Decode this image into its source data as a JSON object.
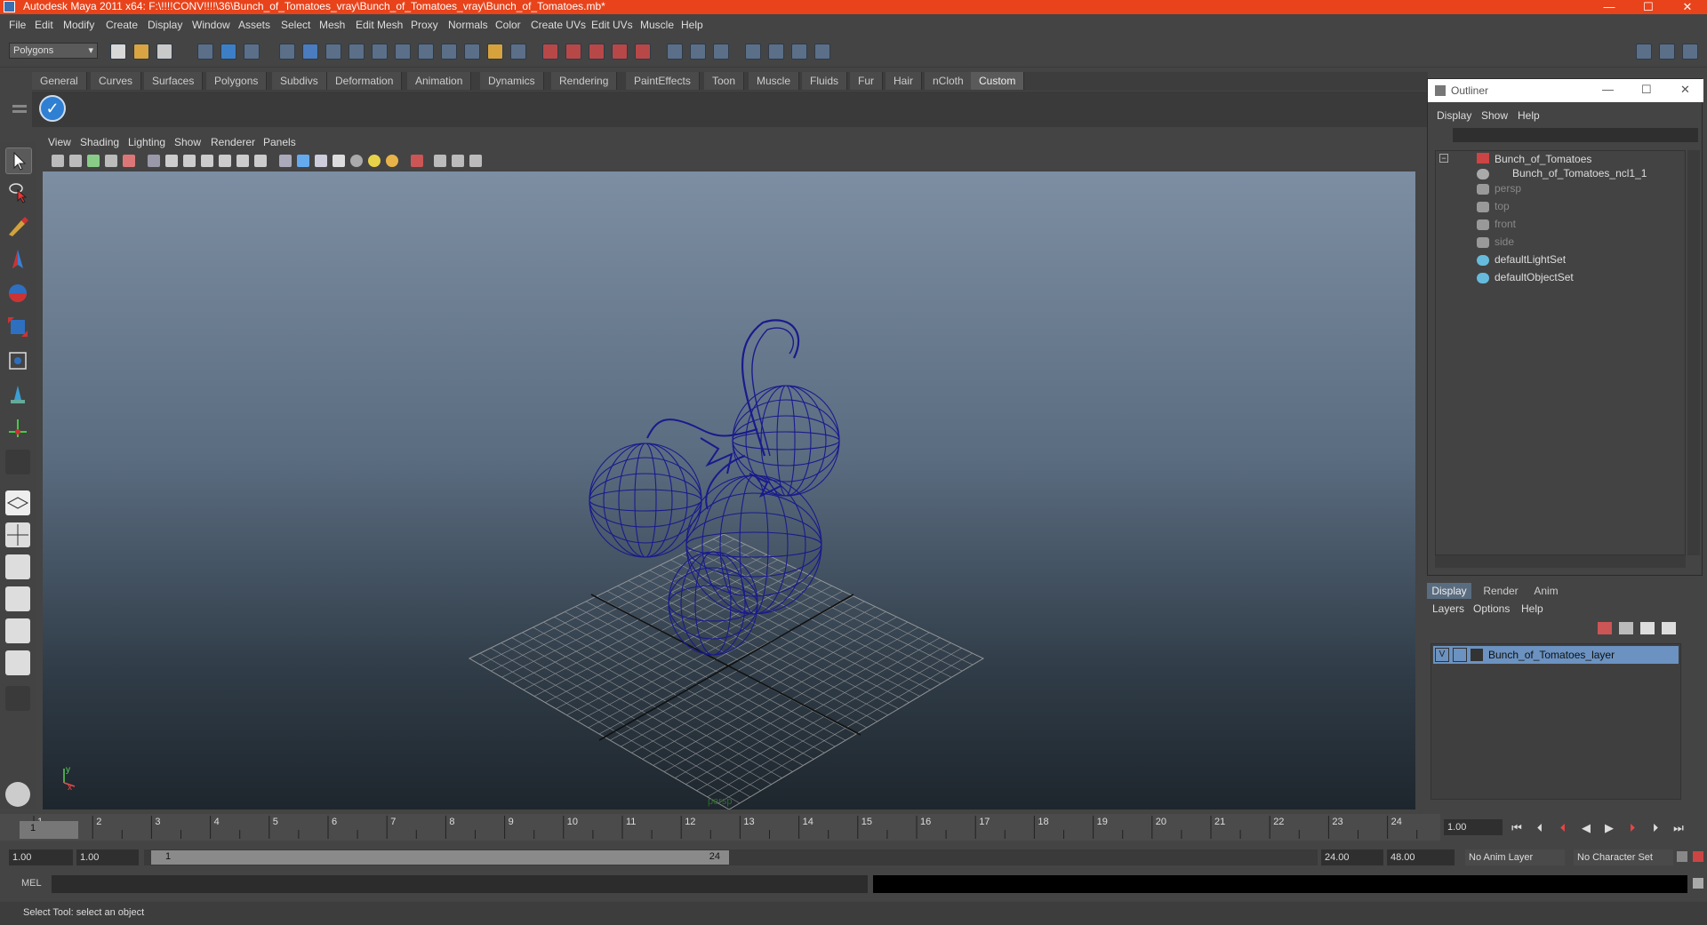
{
  "window": {
    "title": "Autodesk Maya 2011 x64: F:\\!!!!CONV!!!!\\36\\Bunch_of_Tomatoes_vray\\Bunch_of_Tomatoes_vray\\Bunch_of_Tomatoes.mb*",
    "minimize": "—",
    "maximize": "☐",
    "close": "✕"
  },
  "menubar": [
    "File",
    "Edit",
    "Modify",
    "Create",
    "Display",
    "Window",
    "Assets",
    "Select",
    "Mesh",
    "Edit Mesh",
    "Proxy",
    "Normals",
    "Color",
    "Create UVs",
    "Edit UVs",
    "Muscle",
    "Help"
  ],
  "mode_select": "Polygons",
  "shelf_tabs": [
    "General",
    "Curves",
    "Surfaces",
    "Polygons",
    "Subdivs",
    "Deformation",
    "Animation",
    "Dynamics",
    "Rendering",
    "PaintEffects",
    "Toon",
    "Muscle",
    "Fluids",
    "Fur",
    "Hair",
    "nCloth",
    "Custom"
  ],
  "shelf_active": "Custom",
  "viewport": {
    "menu": [
      "View",
      "Shading",
      "Lighting",
      "Show",
      "Renderer",
      "Panels"
    ],
    "camera_label": "persp",
    "axis_y": "y",
    "axis_x": "x"
  },
  "outliner": {
    "title": "Outliner",
    "menu": [
      "Display",
      "Show",
      "Help"
    ],
    "items": [
      {
        "label": "Bunch_of_Tomatoes",
        "dim": false
      },
      {
        "label": "Bunch_of_Tomatoes_ncl1_1",
        "dim": false
      },
      {
        "label": "persp",
        "dim": true
      },
      {
        "label": "top",
        "dim": true
      },
      {
        "label": "front",
        "dim": true
      },
      {
        "label": "side",
        "dim": true
      },
      {
        "label": "defaultLightSet",
        "dim": false
      },
      {
        "label": "defaultObjectSet",
        "dim": false
      }
    ]
  },
  "layers": {
    "tabs": [
      "Display",
      "Render",
      "Anim"
    ],
    "menu": [
      "Layers",
      "Options",
      "Help"
    ],
    "visible_flag": "V",
    "layer_name": "Bunch_of_Tomatoes_layer"
  },
  "timeline": {
    "ticks": [
      "1",
      "2",
      "3",
      "4",
      "5",
      "6",
      "7",
      "8",
      "9",
      "10",
      "11",
      "12",
      "13",
      "14",
      "15",
      "16",
      "17",
      "18",
      "19",
      "20",
      "21",
      "22",
      "23",
      "24"
    ],
    "current_frame_marker": "1",
    "current_time": "1.00"
  },
  "range": {
    "start": "1.00",
    "playback_start": "1.00",
    "slider_start": "1",
    "slider_end": "24",
    "playback_end": "24.00",
    "end": "48.00",
    "anim_layer": "No Anim Layer",
    "character_set": "No Character Set"
  },
  "command": {
    "label": "MEL"
  },
  "help_line": "Select Tool: select an object",
  "colors": {
    "title_bar": "#e8431b",
    "wire": "#1a1a8c",
    "layer_highlight": "#6b92c0"
  }
}
